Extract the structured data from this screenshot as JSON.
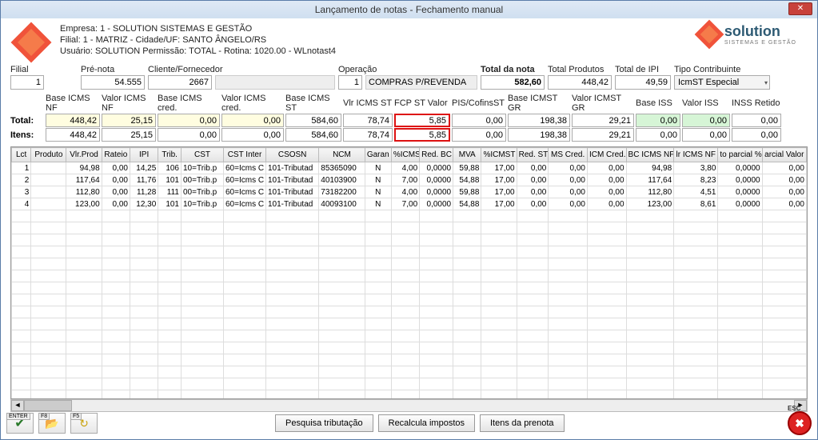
{
  "window": {
    "title": "Lançamento de notas - Fechamento manual"
  },
  "header": {
    "line1": "Empresa: 1 - SOLUTION SISTEMAS E GESTÃO",
    "line2": "Filial: 1 - MATRIZ - Cidade/UF: SANTO ÂNGELO/RS",
    "line3": "Usuário: SOLUTION          Permissão: TOTAL - Rotina: 1020.00 - WLnotast4",
    "brand": "solution",
    "brand_sub": "SISTEMAS E GESTÃO"
  },
  "top": {
    "filial_label": "Filial",
    "filial": "1",
    "prenota_label": "Pré-nota",
    "prenota": "54.555",
    "clifor_label": "Cliente/Fornecedor",
    "clifor": "2667",
    "operacao_label": "Operação",
    "operacao_cod": "1",
    "operacao_desc": "COMPRAS P/REVENDA",
    "totalnota_label": "Total da nota",
    "totalnota": "582,60",
    "totalprod_label": "Total Produtos",
    "totalprod": "448,42",
    "totalipi_label": "Total de IPI",
    "totalipi": "49,59",
    "tipocontrib_label": "Tipo Contribuinte",
    "tipocontrib": "IcmST Especial"
  },
  "sums": {
    "labels": {
      "base_icms_nf": "Base ICMS NF",
      "valor_icms_nf": "Valor ICMS NF",
      "base_icms_cred": "Base ICMS cred.",
      "valor_icms_cred": "Valor ICMS cred.",
      "base_icms_st": "Base ICMS ST",
      "vlr_icms_st": "Vlr ICMS ST",
      "fcp_st": "FCP ST Valor",
      "piscofins_st": "PIS/CofinsST",
      "base_icmst_gr": "Base ICMST GR",
      "valor_icmst_gr": "Valor ICMST GR",
      "base_iss": "Base ISS",
      "valor_iss": "Valor ISS",
      "inss_retido": "INSS Retido"
    },
    "rowlabels": {
      "total": "Total:",
      "itens": "Itens:"
    },
    "total": {
      "base_icms_nf": "448,42",
      "valor_icms_nf": "25,15",
      "base_icms_cred": "0,00",
      "valor_icms_cred": "0,00",
      "base_icms_st": "584,60",
      "vlr_icms_st": "78,74",
      "fcp_st": "5,85",
      "piscofins_st": "0,00",
      "base_icmst_gr": "198,38",
      "valor_icmst_gr": "29,21",
      "base_iss": "0,00",
      "valor_iss": "0,00",
      "inss_retido": "0,00"
    },
    "itens": {
      "base_icms_nf": "448,42",
      "valor_icms_nf": "25,15",
      "base_icms_cred": "0,00",
      "valor_icms_cred": "0,00",
      "base_icms_st": "584,60",
      "vlr_icms_st": "78,74",
      "fcp_st": "5,85",
      "piscofins_st": "0,00",
      "base_icmst_gr": "198,38",
      "valor_icmst_gr": "29,21",
      "base_iss": "0,00",
      "valor_iss": "0,00",
      "inss_retido": "0,00"
    }
  },
  "grid": {
    "columns": [
      "Lct",
      "Produto",
      "Vlr.Prod",
      "Rateio",
      "IPI",
      "Trib.",
      "CST",
      "CST Inter",
      "CSOSN",
      "NCM",
      "Garan",
      "%ICMS",
      "Red. BC",
      "MVA",
      "%ICMST",
      "Red. ST",
      "MS Cred.",
      "ICM Cred.",
      "BC ICMS NF",
      "lr ICMS NF",
      "to parcial %",
      "arcial Valor"
    ],
    "rows": [
      {
        "lct": "1",
        "prod": "",
        "vlrp": "94,98",
        "rateio": "0,00",
        "ipi": "14,25",
        "trib": "106",
        "cst": "10=Trib.p",
        "cstint": "60=Icms C",
        "csosn": "101-Tributad",
        "ncm": "85365090",
        "garan": "N",
        "picms": "4,00",
        "redbc": "0,0000",
        "mva": "59,88",
        "picmst": "17,00",
        "redst": "0,00",
        "mscred": "0,00",
        "icmcred": "0,00",
        "bcicms": "94,98",
        "vlricms": "3,80",
        "parperc": "0,0000",
        "parval": "0,00"
      },
      {
        "lct": "2",
        "prod": "",
        "vlrp": "117,64",
        "rateio": "0,00",
        "ipi": "11,76",
        "trib": "101",
        "cst": "00=Trib.p",
        "cstint": "60=Icms C",
        "csosn": "101-Tributad",
        "ncm": "40103900",
        "garan": "N",
        "picms": "7,00",
        "redbc": "0,0000",
        "mva": "54,88",
        "picmst": "17,00",
        "redst": "0,00",
        "mscred": "0,00",
        "icmcred": "0,00",
        "bcicms": "117,64",
        "vlricms": "8,23",
        "parperc": "0,0000",
        "parval": "0,00"
      },
      {
        "lct": "3",
        "prod": "",
        "vlrp": "112,80",
        "rateio": "0,00",
        "ipi": "11,28",
        "trib": "111",
        "cst": "00=Trib.p",
        "cstint": "60=Icms C",
        "csosn": "101-Tributad",
        "ncm": "73182200",
        "garan": "N",
        "picms": "4,00",
        "redbc": "0,0000",
        "mva": "59,88",
        "picmst": "17,00",
        "redst": "0,00",
        "mscred": "0,00",
        "icmcred": "0,00",
        "bcicms": "112,80",
        "vlricms": "4,51",
        "parperc": "0,0000",
        "parval": "0,00"
      },
      {
        "lct": "4",
        "prod": "",
        "vlrp": "123,00",
        "rateio": "0,00",
        "ipi": "12,30",
        "trib": "101",
        "cst": "10=Trib.p",
        "cstint": "60=Icms C",
        "csosn": "101-Tributad",
        "ncm": "40093100",
        "garan": "N",
        "picms": "7,00",
        "redbc": "0,0000",
        "mva": "54,88",
        "picmst": "17,00",
        "redst": "0,00",
        "mscred": "0,00",
        "icmcred": "0,00",
        "bcicms": "123,00",
        "vlricms": "8,61",
        "parperc": "0,0000",
        "parval": "0,00"
      }
    ]
  },
  "footer": {
    "enter": "ENTER",
    "f8": "F8",
    "f5": "F5",
    "pesquisa": "Pesquisa tributação",
    "recalcula": "Recalcula impostos",
    "itens_prenota": "Itens da prenota",
    "esc": "ESC"
  }
}
